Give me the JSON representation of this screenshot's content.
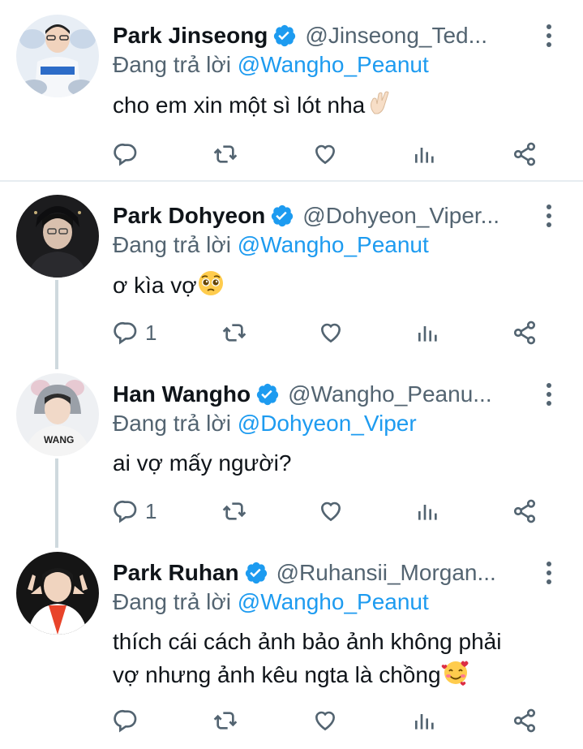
{
  "colors": {
    "accent": "#1d9bf0",
    "text": "#0f1419",
    "secondary": "#536471",
    "thread_line": "#cfd9de",
    "divider": "#e6ecf0"
  },
  "reply_prefix": "Đang trả lời",
  "tweets": [
    {
      "name": "Park Jinseong",
      "handle": "@Jinseong_Ted...",
      "reply_to": "@Wangho_Peanut",
      "text": "cho em xin một sì lót nha",
      "emoji": "crossed-fingers",
      "reply_count": ""
    },
    {
      "name": "Park Dohyeon",
      "handle": "@Dohyeon_Viper...",
      "reply_to": "@Wangho_Peanut",
      "text": "ơ kìa vợ",
      "emoji": "pleading-face",
      "reply_count": "1"
    },
    {
      "name": "Han Wangho",
      "handle": "@Wangho_Peanu...",
      "reply_to": "@Dohyeon_Viper",
      "text": "ai vợ mấy người?",
      "emoji": "",
      "reply_count": "1"
    },
    {
      "name": "Park Ruhan",
      "handle": "@Ruhansii_Morgan...",
      "reply_to": "@Wangho_Peanut",
      "text_line1": "thích cái cách ảnh bảo ảnh không phải",
      "text_line2": "vợ nhưng ảnh kêu ngta là chồng",
      "emoji": "smiling-face-with-hearts",
      "reply_count": ""
    }
  ]
}
